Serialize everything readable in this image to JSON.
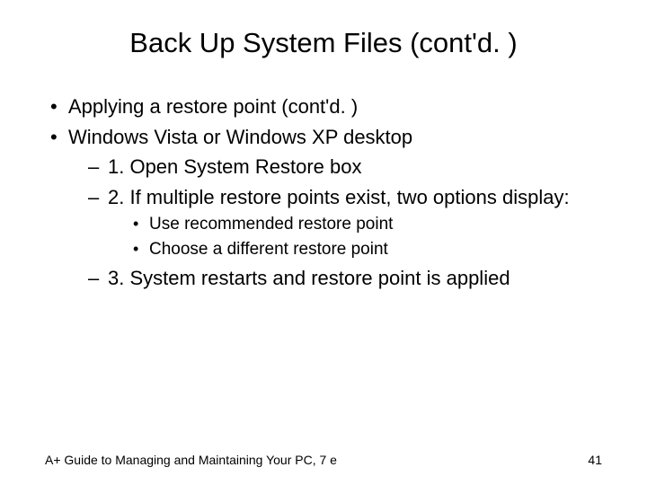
{
  "title": "Back Up System Files (cont'd. )",
  "bullets": {
    "b1": "Applying a restore point (cont'd. )",
    "b2": "Windows Vista or Windows XP desktop",
    "s1": "1. Open System Restore box",
    "s2": "2. If multiple restore points exist, two options display:",
    "ss1": "Use recommended restore point",
    "ss2": "Choose a different restore point",
    "s3": "3. System restarts and restore point is applied"
  },
  "footer": {
    "left": "A+ Guide to Managing and Maintaining Your PC, 7 e",
    "right": "41"
  }
}
